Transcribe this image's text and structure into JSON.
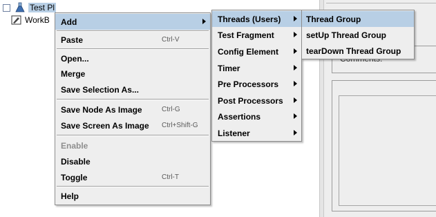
{
  "tree": {
    "items": [
      {
        "label": "Test Pl",
        "selected": true,
        "icon": "test-plan-flask-icon"
      },
      {
        "label": "WorkB",
        "selected": false,
        "icon": "workbench-icon"
      }
    ]
  },
  "right_panel": {
    "comments_label": "Comments:"
  },
  "context_menu": {
    "items": [
      {
        "label": "Add",
        "shortcut": "",
        "submenu": true,
        "highlighted": true,
        "enabled": true
      },
      {
        "label": "Paste",
        "shortcut": "Ctrl-V",
        "enabled": true
      },
      {
        "label": "Open...",
        "shortcut": "",
        "enabled": true
      },
      {
        "label": "Merge",
        "shortcut": "",
        "enabled": true
      },
      {
        "label": "Save Selection As...",
        "shortcut": "",
        "enabled": true
      },
      {
        "label": "Save Node As Image",
        "shortcut": "Ctrl-G",
        "enabled": true
      },
      {
        "label": "Save Screen As Image",
        "shortcut": "Ctrl+Shift-G",
        "enabled": true
      },
      {
        "label": "Enable",
        "shortcut": "",
        "enabled": false
      },
      {
        "label": "Disable",
        "shortcut": "",
        "enabled": true
      },
      {
        "label": "Toggle",
        "shortcut": "Ctrl-T",
        "enabled": true
      },
      {
        "label": "Help",
        "shortcut": "",
        "enabled": true
      }
    ]
  },
  "add_submenu": {
    "items": [
      {
        "label": "Threads (Users)",
        "submenu": true,
        "highlighted": true
      },
      {
        "label": "Test Fragment",
        "submenu": true
      },
      {
        "label": "Config Element",
        "submenu": true
      },
      {
        "label": "Timer",
        "submenu": true
      },
      {
        "label": "Pre Processors",
        "submenu": true
      },
      {
        "label": "Post Processors",
        "submenu": true
      },
      {
        "label": "Assertions",
        "submenu": true
      },
      {
        "label": "Listener",
        "submenu": true
      }
    ]
  },
  "threads_submenu": {
    "items": [
      {
        "label": "Thread Group",
        "highlighted": true
      },
      {
        "label": "setUp Thread Group"
      },
      {
        "label": "tearDown Thread Group"
      }
    ]
  },
  "colors": {
    "menu_bg": "#eeeeee",
    "highlight": "#b8cfe5",
    "disabled_text": "#8e8e8e"
  }
}
